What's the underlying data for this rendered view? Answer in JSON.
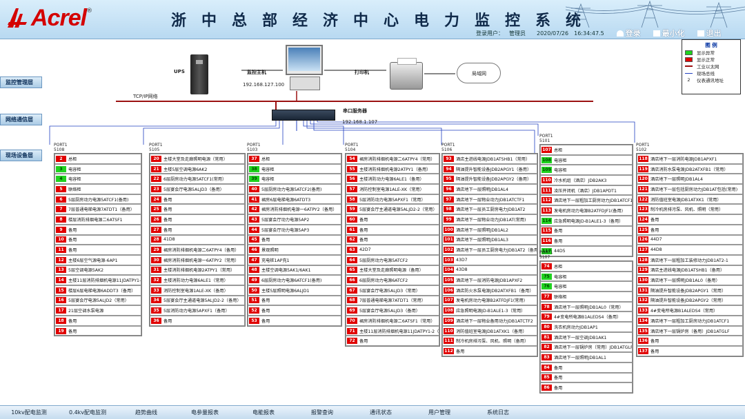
{
  "header": {
    "logo_text": "Acrel",
    "title": "浙中总部经济中心电力监控系统",
    "user_label": "登录用户：",
    "user_name": "管理员",
    "date": "2020/07/26",
    "time": "16:34:47.5",
    "login_label": "登录",
    "minimize_label": "最小化",
    "exit_label": "退出"
  },
  "levels": {
    "monitor": "监控管理层",
    "network": "网络通信层",
    "field": "现场设备层"
  },
  "devices": {
    "ups": "UPS",
    "host": "监控主机",
    "host_ip": "192.168.127.100",
    "printer": "打印机",
    "lan": "局域网",
    "tcp": "TCP/IP网络",
    "serial": "串口服务器",
    "serial_ip": "192.168.1.107"
  },
  "legend": {
    "title": "图  例",
    "items": [
      {
        "label": "显示异常",
        "color": "#1fd21f"
      },
      {
        "label": "显示正常",
        "color": "#e00000"
      },
      {
        "label": "工业以太网",
        "color": "#9b1010"
      },
      {
        "label": "现场总线",
        "color": "#2040c0"
      },
      {
        "label": "仪表通讯地址",
        "num": "2"
      }
    ]
  },
  "columns": [
    {
      "port": "PORT1",
      "port_id": "5108",
      "rows": [
        {
          "n": "2",
          "t": "总柜",
          "s": "red"
        },
        {
          "n": "3",
          "t": "电容柜",
          "s": "grn"
        },
        {
          "n": "4",
          "t": "电容柜",
          "s": "grn"
        },
        {
          "n": "5",
          "t": "联络柜",
          "s": "red"
        },
        {
          "n": "6",
          "t": "5层厨房动力电源5ATCF1(备用)",
          "s": "red"
        },
        {
          "n": "7",
          "t": "7层普通电梯电源7ATDT1（备用）",
          "s": "red"
        },
        {
          "n": "8",
          "t": "楼层消防排烟电源二6ATSF1",
          "s": "red"
        },
        {
          "n": "9",
          "t": "备用",
          "s": "red"
        },
        {
          "n": "10",
          "t": "备用",
          "s": "red"
        },
        {
          "n": "11",
          "t": "备用",
          "s": "red"
        },
        {
          "n": "12",
          "t": "主楼6层空气源电源-6AP1",
          "s": "red"
        },
        {
          "n": "13",
          "t": "5层空调电源5AK2",
          "s": "red"
        },
        {
          "n": "14",
          "t": "主楼11层消防排烟机电源11JDATPY1-2",
          "s": "red"
        },
        {
          "n": "15",
          "t": "楼层6层电梯电源6ADDT3（备用）",
          "s": "red"
        },
        {
          "n": "16",
          "t": "5层宴会厅电源5ALJD2（常用）",
          "s": "red"
        },
        {
          "n": "17",
          "t": "21层空调水泵电源",
          "s": "red"
        },
        {
          "n": "18",
          "t": "备用",
          "s": "red"
        },
        {
          "n": "19",
          "t": "备用",
          "s": "red"
        }
      ]
    },
    {
      "port": "PORT1",
      "port_id": "5105",
      "rows": [
        {
          "n": "20",
          "t": "主楼大堂及走廊照明电源（常用）",
          "s": "red"
        },
        {
          "n": "21",
          "t": "主楼5层空调电源6AK2",
          "s": "red"
        },
        {
          "n": "22",
          "t": "6层厨房动力电源5ATCF1(常用）",
          "s": "red"
        },
        {
          "n": "23",
          "t": "5层宴会厅电源5ALJD3（备用）",
          "s": "red"
        },
        {
          "n": "24",
          "t": "备用",
          "s": "red"
        },
        {
          "n": "25",
          "t": "备用",
          "s": "red"
        },
        {
          "n": "26",
          "t": "备用",
          "s": "red"
        },
        {
          "n": "27",
          "t": "备用",
          "s": "red"
        },
        {
          "n": "28",
          "t": "41D8",
          "s": "red"
        },
        {
          "n": "29",
          "t": "裙房消防排烟机电源二6ATPY4（备用）",
          "s": "red"
        },
        {
          "n": "30",
          "t": "裙房消防排烟机电源一6ATPY2（常用）",
          "s": "red"
        },
        {
          "n": "31",
          "t": "主楼消防排烟机电源2ATPY1（常用）",
          "s": "red"
        },
        {
          "n": "32",
          "t": "主楼消防动力电源6ALE1（常用）",
          "s": "red"
        },
        {
          "n": "33",
          "t": "消防控制室电源1ALE-XK（备用）",
          "s": "red"
        },
        {
          "n": "34",
          "t": "5层宴会厅主通道电源5ALJD2-2（备用）",
          "s": "red"
        },
        {
          "n": "35",
          "t": "5层消防动力电源5APXF1（备用）",
          "s": "red"
        },
        {
          "n": "36",
          "t": "备用",
          "s": "red"
        }
      ]
    },
    {
      "port": "PORT1",
      "port_id": "5103",
      "rows": [
        {
          "n": "37",
          "t": "总柜",
          "s": "red"
        },
        {
          "n": "38",
          "t": "电容柜",
          "s": "grn"
        },
        {
          "n": "39",
          "t": "电容柜",
          "s": "grn"
        },
        {
          "n": "40",
          "t": "5层厨房动力电源5ATCF2(备用)",
          "s": "red"
        },
        {
          "n": "41",
          "t": "裙房6层电梯电源6ATDT3",
          "s": "red"
        },
        {
          "n": "42",
          "t": "裙房消防排烟机电源一6ATPY2（备用）",
          "s": "red"
        },
        {
          "n": "43",
          "t": "5层宴会厅动力电源5AP2",
          "s": "red"
        },
        {
          "n": "44",
          "t": "5层宴会厅动力电源5AP3",
          "s": "red"
        },
        {
          "n": "45",
          "t": "备用",
          "s": "red"
        },
        {
          "n": "46",
          "t": "景观照明",
          "s": "red"
        },
        {
          "n": "47",
          "t": "充电桩1AP充1",
          "s": "red"
        },
        {
          "n": "48",
          "t": "主楼空调电源5AK1/6AK1",
          "s": "red"
        },
        {
          "n": "49",
          "t": "6层厨房动力电源6ATCF1(备用)",
          "s": "red"
        },
        {
          "n": "50",
          "t": "主楼5层照明电源6ALJD1",
          "s": "red"
        },
        {
          "n": "51",
          "t": "备用",
          "s": "red"
        },
        {
          "n": "52",
          "t": "备用",
          "s": "red"
        },
        {
          "n": "53",
          "t": "备用",
          "s": "red"
        }
      ]
    },
    {
      "port": "PORT1",
      "port_id": "5104",
      "rows": [
        {
          "n": "54",
          "t": "裙房消防排烟机电源二6ATPY4（常用）",
          "s": "red"
        },
        {
          "n": "55",
          "t": "主楼消防排烟机电源2ATPY1（备用）",
          "s": "red"
        },
        {
          "n": "56",
          "t": "主楼消防动力电源6ALE1（备用）",
          "s": "red"
        },
        {
          "n": "57",
          "t": "消防控制室电源1ALE-XK（常用）",
          "s": "red"
        },
        {
          "n": "58",
          "t": "5层消防动力电源5APXF1（常用）",
          "s": "red"
        },
        {
          "n": "59",
          "t": "5层宴会厅主通道电源5ALJD2-2（常用）",
          "s": "red"
        },
        {
          "n": "60",
          "t": "备用",
          "s": "red"
        },
        {
          "n": "61",
          "t": "备用",
          "s": "red"
        },
        {
          "n": "62",
          "t": "备用",
          "s": "red"
        },
        {
          "n": "63",
          "t": "42D7",
          "s": "red"
        },
        {
          "n": "64",
          "t": "5层厨房动力电源5ATCF2",
          "s": "red"
        },
        {
          "n": "65",
          "t": "主楼大堂及走廊照明电源（备用）",
          "s": "red"
        },
        {
          "n": "66",
          "t": "6层厨房动力电源6ATCF2",
          "s": "red"
        },
        {
          "n": "67",
          "t": "5层宴会厅电源5ALJD3（常用）",
          "s": "red"
        },
        {
          "n": "68",
          "t": "7层普通电梯电源7ATDT1（常用）",
          "s": "red"
        },
        {
          "n": "69",
          "t": "5层宴会厅电源5ALJD3（备用）",
          "s": "red"
        },
        {
          "n": "70",
          "t": "裙房消防排烟机电源二6ATSF1（常用）",
          "s": "red"
        },
        {
          "n": "71",
          "t": "主楼11层消防排烟机电源11JDATPY1-2（常用）",
          "s": "red"
        },
        {
          "n": "72",
          "t": "备用",
          "s": "red"
        }
      ]
    },
    {
      "port": "PORT1",
      "port_id": "5106",
      "rows": [
        {
          "n": "93",
          "t": "酒店主进线电源JDB1ATSHB1（常用）",
          "s": "red"
        },
        {
          "n": "94",
          "t": "隔油提升智能设备JDB2APGY1（备用）",
          "s": "red"
        },
        {
          "n": "95",
          "t": "隔油提升智能设备JDB2APGY2（备用）",
          "s": "red"
        },
        {
          "n": "96",
          "t": "酒店地下一层照明JDB1AL4",
          "s": "red"
        },
        {
          "n": "97",
          "t": "酒店地下一层物业动力JDB1ATCTF1",
          "s": "red"
        },
        {
          "n": "98",
          "t": "酒店地下一层员工厨房电力JDB1AT2",
          "s": "red"
        },
        {
          "n": "99",
          "t": "酒店地下一层物业动力JDB1AT(常用)",
          "s": "red"
        },
        {
          "n": "100",
          "t": "酒店地下一层照明JDB1AL2",
          "s": "red"
        },
        {
          "n": "101",
          "t": "酒店地下一层照明JDB1AL3",
          "s": "red"
        },
        {
          "n": "102",
          "t": "酒店地下一层员工厨房电力JDB1AT2（备用）",
          "s": "red"
        },
        {
          "n": "103",
          "t": "43D7",
          "s": "red"
        },
        {
          "n": "104",
          "t": "43D8",
          "s": "red"
        },
        {
          "n": "105",
          "t": "酒店地下一层消防电源JDB1APXF2",
          "s": "red"
        },
        {
          "n": "106",
          "t": "酒店防火水泵电源JDB2ATXFB1（备用）",
          "s": "red"
        },
        {
          "n": "107",
          "t": "发电机房动力电源B2ATFDJF1(常用)",
          "s": "red"
        },
        {
          "n": "108",
          "t": "应急照明电源JD-B1ALE1-3（常用）",
          "s": "red"
        },
        {
          "n": "109",
          "t": "酒店地下一层物业备用动力JDB1ATCTF2",
          "s": "red"
        },
        {
          "n": "110",
          "t": "消防值班室电源JDB1ATXK1（备用）",
          "s": "red"
        },
        {
          "n": "111",
          "t": "制冷机房排污泵、风机、照明（备用）",
          "s": "red"
        },
        {
          "n": "112",
          "t": "备用",
          "s": "red"
        }
      ]
    },
    {
      "port": "PORT1",
      "port_id": "5101",
      "rows": [
        {
          "n": "107",
          "t": "总柜",
          "s": "red"
        },
        {
          "n": "108",
          "t": "电容柜",
          "s": "grn"
        },
        {
          "n": "109",
          "t": "电容柜",
          "s": "grn"
        },
        {
          "n": "110",
          "t": "冷水机组（酒店）JDB2AK3",
          "s": "red"
        },
        {
          "n": "111",
          "t": "凌压开闭机（酒店）JDB1APDT1",
          "s": "red"
        },
        {
          "n": "112",
          "t": "酒店地下一层粗加工厨房动力JDB1ATCF1",
          "s": "red"
        },
        {
          "n": "113",
          "t": "发电机房动力电源B2ATFDJF1(备用)",
          "s": "red"
        },
        {
          "n": "114",
          "t": "应急照明电源JD-B1ALE1-3（备用）",
          "s": "grn"
        },
        {
          "n": "115",
          "t": "备用",
          "s": "red"
        },
        {
          "n": "116",
          "t": "备用",
          "s": "red"
        },
        {
          "n": "117",
          "t": "44D5",
          "s": "grn"
        }
      ]
    },
    {
      "port": "PORT1",
      "port_id": "5107",
      "rows": [
        {
          "n": "74",
          "t": "总柜",
          "s": "red"
        },
        {
          "n": "75",
          "t": "电容柜",
          "s": "grn"
        },
        {
          "n": "76",
          "t": "电容柜",
          "s": "grn"
        },
        {
          "n": "77",
          "t": "联络柜",
          "s": "red"
        },
        {
          "n": "78",
          "t": "酒店地下一层照明JDB1AL0（常用）",
          "s": "red"
        },
        {
          "n": "79",
          "t": "4#变电所电源B1ALEDS4（备用）",
          "s": "red"
        },
        {
          "n": "80",
          "t": "洗衣机房动力JDB1AP1",
          "s": "red"
        },
        {
          "n": "81",
          "t": "酒店地下一层空调JDB1AK1",
          "s": "red"
        },
        {
          "n": "82",
          "t": "酒店地下一层锅炉房（常用）JDB1ATGLF",
          "s": "red"
        },
        {
          "n": "83",
          "t": "酒店地下一层照明JDB1AL1",
          "s": "red"
        },
        {
          "n": "84",
          "t": "备用",
          "s": "red"
        },
        {
          "n": "85",
          "t": "备用",
          "s": "red"
        },
        {
          "n": "86",
          "t": "备用",
          "s": "red"
        }
      ]
    },
    {
      "port": "PORT1",
      "port_id": "5102",
      "rows": [
        {
          "n": "118",
          "t": "酒店地下一层消防电源JDB1APXF1",
          "s": "red"
        },
        {
          "n": "119",
          "t": "酒店消防水泵电源JDB2ATXFB1（常用）",
          "s": "red"
        },
        {
          "n": "120",
          "t": "酒店地下一层照明JDB1AL4",
          "s": "red"
        },
        {
          "n": "121",
          "t": "酒店地下一层包括厨房动力JDB1AT包括(常用)",
          "s": "red"
        },
        {
          "n": "122",
          "t": "消防值班室电源JDB1ATXK1（常用）",
          "s": "red"
        },
        {
          "n": "123",
          "t": "制冷机房排污泵、风机、照明（常用）",
          "s": "red"
        },
        {
          "n": "124",
          "t": "备用",
          "s": "red"
        },
        {
          "n": "125",
          "t": "备用",
          "s": "red"
        },
        {
          "n": "126",
          "t": "44D7",
          "s": "red"
        },
        {
          "n": "127",
          "t": "44D8",
          "s": "red"
        },
        {
          "n": "128",
          "t": "酒店地下一层粗加工装修动力JDB1AT2-1",
          "s": "red"
        },
        {
          "n": "129",
          "t": "酒店主进线电源JDB1ATSHB1（备用）",
          "s": "red"
        },
        {
          "n": "130",
          "t": "酒店地下一层照明JDB1AL0（备用）",
          "s": "red"
        },
        {
          "n": "131",
          "t": "隔油提升智能设备JDB2APGY1（常用）",
          "s": "red"
        },
        {
          "n": "132",
          "t": "隔油提升智能设备JDB2APGY2（常用）",
          "s": "red"
        },
        {
          "n": "133",
          "t": "4#变电所电源B1ALEDS4（常用）",
          "s": "red"
        },
        {
          "n": "134",
          "t": "酒店地下一层粗加工厨房动力JDB1ATCF1",
          "s": "red"
        },
        {
          "n": "135",
          "t": "酒店地下一层锅炉房（备用）JDB1ATGLF",
          "s": "red"
        },
        {
          "n": "136",
          "t": "备用",
          "s": "red"
        },
        {
          "n": "137",
          "t": "备用",
          "s": "red"
        }
      ]
    }
  ],
  "footer": [
    "10kv配电监测",
    "0.4kv配电监测",
    "趋势曲线",
    "电参量报表",
    "电能报表",
    "报警查询",
    "通讯状态",
    "用户管理",
    "系统日志"
  ]
}
